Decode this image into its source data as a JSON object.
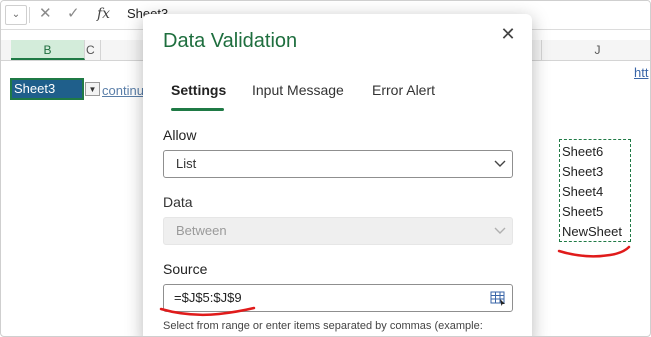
{
  "formula_bar": {
    "dropdown": "⌄",
    "cancel": "✕",
    "enter": "✓",
    "fx": "fx",
    "content": "Sheet3"
  },
  "columns": {
    "b": "B",
    "c": "C",
    "j": "J"
  },
  "cells": {
    "selected_value": "Sheet3",
    "continue_text": "continue",
    "link_text": "htt",
    "list_items": [
      "Sheet6",
      "Sheet3",
      "Sheet4",
      "Sheet5",
      "NewSheet"
    ]
  },
  "dialog": {
    "title": "Data Validation",
    "close": "✕",
    "tabs": [
      {
        "label": "Settings",
        "active": true
      },
      {
        "label": "Input Message",
        "active": false
      },
      {
        "label": "Error Alert",
        "active": false
      }
    ],
    "allow_label": "Allow",
    "allow_value": "List",
    "data_label": "Data",
    "data_value": "Between",
    "source_label": "Source",
    "source_value": "=$J$5:$J$9",
    "hint": "Select from range or enter items separated by commas (example:"
  },
  "colors": {
    "accent": "#1f7a45",
    "selection": "#1f5f8b",
    "annotation": "#e01b1b"
  }
}
